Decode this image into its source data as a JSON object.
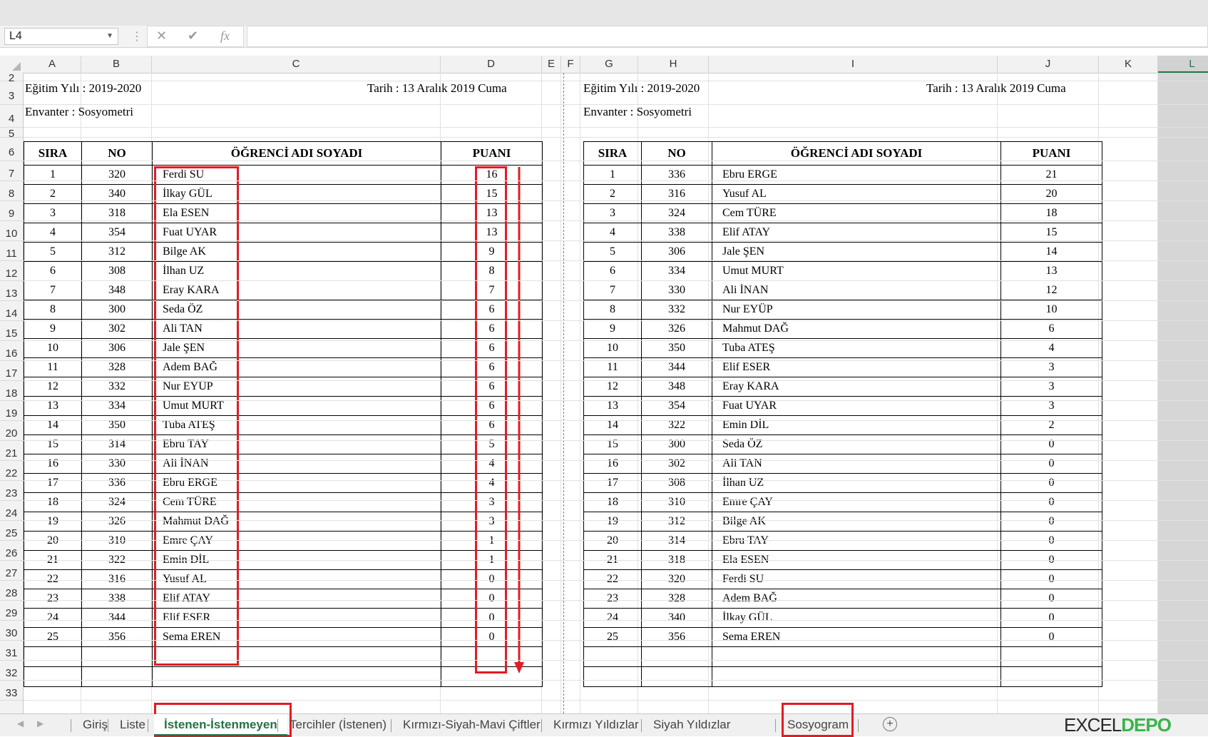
{
  "formula_bar": {
    "name_box": "L4",
    "cancel_icon": "✕",
    "enter_icon": "✔",
    "fx": "fx",
    "content": ""
  },
  "columns": [
    "A",
    "B",
    "C",
    "D",
    "E",
    "F",
    "G",
    "H",
    "I",
    "J",
    "K",
    "L"
  ],
  "selected_column": "L",
  "rows": [
    "2",
    "3",
    "4",
    "5",
    "6",
    "7",
    "8",
    "9",
    "10",
    "11",
    "12",
    "13",
    "14",
    "15",
    "16",
    "17",
    "18",
    "19",
    "20",
    "21",
    "22",
    "23",
    "24",
    "25",
    "26",
    "27",
    "28",
    "29",
    "30",
    "31",
    "32",
    "33"
  ],
  "left_sheet": {
    "year": "Eğitim Yılı : 2019-2020",
    "date": "Tarih : 13 Aralık 2019 Cuma",
    "inventory": "Envanter : Sosyometri",
    "headers": {
      "sira": "SIRA",
      "no": "NO",
      "name": "ÖĞRENCİ ADI SOYADI",
      "score": "PUANI"
    },
    "rows": [
      {
        "sira": "1",
        "no": "320",
        "name": "Ferdi SU",
        "score": "16"
      },
      {
        "sira": "2",
        "no": "340",
        "name": "İlkay GÜL",
        "score": "15"
      },
      {
        "sira": "3",
        "no": "318",
        "name": "Ela ESEN",
        "score": "13"
      },
      {
        "sira": "4",
        "no": "354",
        "name": "Fuat UYAR",
        "score": "13"
      },
      {
        "sira": "5",
        "no": "312",
        "name": "Bilge AK",
        "score": "9"
      },
      {
        "sira": "6",
        "no": "308",
        "name": "İlhan UZ",
        "score": "8"
      },
      {
        "sira": "7",
        "no": "348",
        "name": "Eray KARA",
        "score": "7"
      },
      {
        "sira": "8",
        "no": "300",
        "name": "Seda ÖZ",
        "score": "6"
      },
      {
        "sira": "9",
        "no": "302",
        "name": "Ali TAN",
        "score": "6"
      },
      {
        "sira": "10",
        "no": "306",
        "name": "Jale ŞEN",
        "score": "6"
      },
      {
        "sira": "11",
        "no": "328",
        "name": "Adem BAĞ",
        "score": "6"
      },
      {
        "sira": "12",
        "no": "332",
        "name": "Nur EYÜP",
        "score": "6"
      },
      {
        "sira": "13",
        "no": "334",
        "name": "Umut MURT",
        "score": "6"
      },
      {
        "sira": "14",
        "no": "350",
        "name": "Tuba ATEŞ",
        "score": "6"
      },
      {
        "sira": "15",
        "no": "314",
        "name": "Ebru TAY",
        "score": "5"
      },
      {
        "sira": "16",
        "no": "330",
        "name": "Ali İNAN",
        "score": "4"
      },
      {
        "sira": "17",
        "no": "336",
        "name": "Ebru ERGE",
        "score": "4"
      },
      {
        "sira": "18",
        "no": "324",
        "name": "Cem TÜRE",
        "score": "3"
      },
      {
        "sira": "19",
        "no": "326",
        "name": "Mahmut DAĞ",
        "score": "3"
      },
      {
        "sira": "20",
        "no": "310",
        "name": "Emre ÇAY",
        "score": "1"
      },
      {
        "sira": "21",
        "no": "322",
        "name": "Emin DİL",
        "score": "1"
      },
      {
        "sira": "22",
        "no": "316",
        "name": "Yusuf AL",
        "score": "0"
      },
      {
        "sira": "23",
        "no": "338",
        "name": "Elif ATAY",
        "score": "0"
      },
      {
        "sira": "24",
        "no": "344",
        "name": "Elif ESER",
        "score": "0"
      },
      {
        "sira": "25",
        "no": "356",
        "name": "Sema EREN",
        "score": "0"
      }
    ]
  },
  "right_sheet": {
    "year": "Eğitim Yılı : 2019-2020",
    "date": "Tarih : 13 Aralık 2019 Cuma",
    "inventory": "Envanter : Sosyometri",
    "headers": {
      "sira": "SIRA",
      "no": "NO",
      "name": "ÖĞRENCİ ADI SOYADI",
      "score": "PUANI"
    },
    "rows": [
      {
        "sira": "1",
        "no": "336",
        "name": "Ebru ERGE",
        "score": "21"
      },
      {
        "sira": "2",
        "no": "316",
        "name": "Yusuf AL",
        "score": "20"
      },
      {
        "sira": "3",
        "no": "324",
        "name": "Cem TÜRE",
        "score": "18"
      },
      {
        "sira": "4",
        "no": "338",
        "name": "Elif ATAY",
        "score": "15"
      },
      {
        "sira": "5",
        "no": "306",
        "name": "Jale ŞEN",
        "score": "14"
      },
      {
        "sira": "6",
        "no": "334",
        "name": "Umut MURT",
        "score": "13"
      },
      {
        "sira": "7",
        "no": "330",
        "name": "Ali İNAN",
        "score": "12"
      },
      {
        "sira": "8",
        "no": "332",
        "name": "Nur EYÜP",
        "score": "10"
      },
      {
        "sira": "9",
        "no": "326",
        "name": "Mahmut DAĞ",
        "score": "6"
      },
      {
        "sira": "10",
        "no": "350",
        "name": "Tuba ATEŞ",
        "score": "4"
      },
      {
        "sira": "11",
        "no": "344",
        "name": "Elif ESER",
        "score": "3"
      },
      {
        "sira": "12",
        "no": "348",
        "name": "Eray KARA",
        "score": "3"
      },
      {
        "sira": "13",
        "no": "354",
        "name": "Fuat UYAR",
        "score": "3"
      },
      {
        "sira": "14",
        "no": "322",
        "name": "Emin DİL",
        "score": "2"
      },
      {
        "sira": "15",
        "no": "300",
        "name": "Seda ÖZ",
        "score": "0"
      },
      {
        "sira": "16",
        "no": "302",
        "name": "Ali TAN",
        "score": "0"
      },
      {
        "sira": "17",
        "no": "308",
        "name": "İlhan UZ",
        "score": "0"
      },
      {
        "sira": "18",
        "no": "310",
        "name": "Emre ÇAY",
        "score": "0"
      },
      {
        "sira": "19",
        "no": "312",
        "name": "Bilge AK",
        "score": "0"
      },
      {
        "sira": "20",
        "no": "314",
        "name": "Ebru TAY",
        "score": "0"
      },
      {
        "sira": "21",
        "no": "318",
        "name": "Ela ESEN",
        "score": "0"
      },
      {
        "sira": "22",
        "no": "320",
        "name": "Ferdi SU",
        "score": "0"
      },
      {
        "sira": "23",
        "no": "328",
        "name": "Adem BAĞ",
        "score": "0"
      },
      {
        "sira": "24",
        "no": "340",
        "name": "İlkay GÜL",
        "score": "0"
      },
      {
        "sira": "25",
        "no": "356",
        "name": "Sema EREN",
        "score": "0"
      }
    ]
  },
  "sheet_tabs": [
    "Giriş",
    "Liste",
    "İstenen-İstenmeyen",
    "Tercihler (İstenen)",
    "Kırmızı-Siyah-Mavi Çiftler",
    "Kırmızı Yıldızlar",
    "Siyah Yıldızlar",
    "Sosyogram"
  ],
  "active_tab": "İstenen-İstenmeyen",
  "add_sheet_icon": "+",
  "brand": {
    "part1": "EXCEL",
    "part2": "DEPO"
  },
  "colors": {
    "highlight_red": "#e31b23",
    "excel_green": "#217346"
  }
}
